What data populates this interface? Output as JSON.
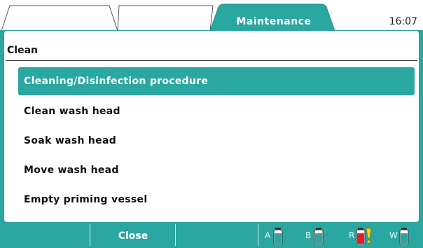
{
  "header": {
    "tabs": [
      {
        "label": ""
      },
      {
        "label": ""
      },
      {
        "label": "Maintenance"
      }
    ],
    "active_tab": "Maintenance",
    "time": "16:07"
  },
  "panel": {
    "title": "Clean",
    "menu_items": [
      {
        "label": "Cleaning/Disinfection procedure",
        "selected": true
      },
      {
        "label": "Clean wash head",
        "selected": false
      },
      {
        "label": "Soak wash head",
        "selected": false
      },
      {
        "label": "Move wash head",
        "selected": false
      },
      {
        "label": "Empty priming vessel",
        "selected": false
      }
    ]
  },
  "footer": {
    "softkeys": [
      "",
      "Close",
      ""
    ],
    "bottles": [
      {
        "letter": "A",
        "state": "normal"
      },
      {
        "letter": "B",
        "state": "normal"
      },
      {
        "letter": "R",
        "state": "warning"
      },
      {
        "letter": "W",
        "state": "normal"
      }
    ]
  },
  "colors": {
    "accent": "#2aa7a0",
    "bottle_normal": "#2aa7a0",
    "bottle_warning": "#e0202a",
    "warning_mark": "#f2d21a"
  }
}
